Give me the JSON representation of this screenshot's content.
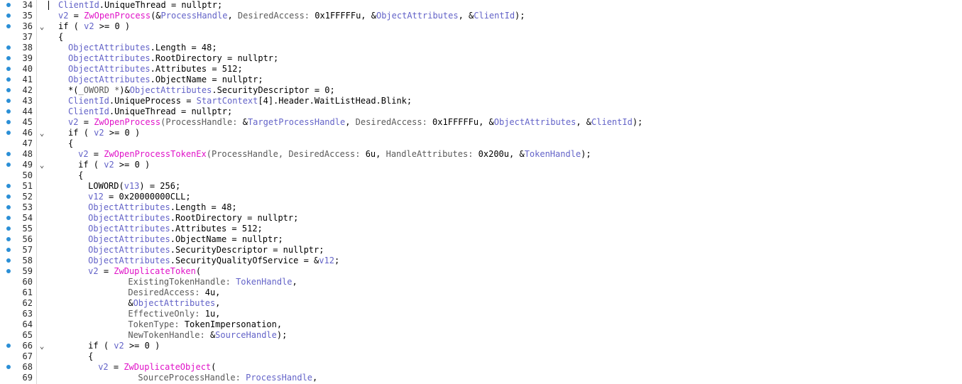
{
  "colors": {
    "default": "#000000",
    "variable": "#6363c8",
    "function": "#e012c8",
    "param_label": "#5a5a5a",
    "breakpoint": "#2b8fd6"
  },
  "icons": {
    "breakpoint": "breakpoint-dot-icon",
    "fold": "fold-chevron-down-icon"
  },
  "lines": [
    {
      "n": "34",
      "bp": true,
      "fold": false,
      "indent": 0,
      "segs": [
        [
          "v",
          "ClientId"
        ],
        [
          "d",
          ".UniqueThread = nullptr;"
        ]
      ]
    },
    {
      "n": "35",
      "bp": true,
      "fold": false,
      "indent": 0,
      "segs": [
        [
          "v",
          "v2"
        ],
        [
          "d",
          " = "
        ],
        [
          "f",
          "ZwOpenProcess"
        ],
        [
          "d",
          "(&"
        ],
        [
          "v",
          "ProcessHandle"
        ],
        [
          "d",
          ", "
        ],
        [
          "p",
          "DesiredAccess: "
        ],
        [
          "d",
          "0x1FFFFFu, &"
        ],
        [
          "v",
          "ObjectAttributes"
        ],
        [
          "d",
          ", &"
        ],
        [
          "v",
          "ClientId"
        ],
        [
          "d",
          ");"
        ]
      ]
    },
    {
      "n": "36",
      "bp": true,
      "fold": true,
      "indent": 0,
      "segs": [
        [
          "d",
          "if ( "
        ],
        [
          "v",
          "v2"
        ],
        [
          "d",
          " >= 0 )"
        ]
      ]
    },
    {
      "n": "37",
      "bp": false,
      "fold": false,
      "indent": 0,
      "segs": [
        [
          "d",
          "{"
        ]
      ]
    },
    {
      "n": "38",
      "bp": true,
      "fold": false,
      "indent": 1,
      "segs": [
        [
          "v",
          "ObjectAttributes"
        ],
        [
          "d",
          ".Length = 48;"
        ]
      ]
    },
    {
      "n": "39",
      "bp": true,
      "fold": false,
      "indent": 1,
      "segs": [
        [
          "v",
          "ObjectAttributes"
        ],
        [
          "d",
          ".RootDirectory = nullptr;"
        ]
      ]
    },
    {
      "n": "40",
      "bp": true,
      "fold": false,
      "indent": 1,
      "segs": [
        [
          "v",
          "ObjectAttributes"
        ],
        [
          "d",
          ".Attributes = 512;"
        ]
      ]
    },
    {
      "n": "41",
      "bp": true,
      "fold": false,
      "indent": 1,
      "segs": [
        [
          "v",
          "ObjectAttributes"
        ],
        [
          "d",
          ".ObjectName = nullptr;"
        ]
      ]
    },
    {
      "n": "42",
      "bp": true,
      "fold": false,
      "indent": 1,
      "segs": [
        [
          "d",
          "*("
        ],
        [
          "p",
          "_OWORD *"
        ],
        [
          "d",
          ")&"
        ],
        [
          "v",
          "ObjectAttributes"
        ],
        [
          "d",
          ".SecurityDescriptor = 0;"
        ]
      ]
    },
    {
      "n": "43",
      "bp": true,
      "fold": false,
      "indent": 1,
      "segs": [
        [
          "v",
          "ClientId"
        ],
        [
          "d",
          ".UniqueProcess = "
        ],
        [
          "v",
          "StartContext"
        ],
        [
          "d",
          "[4].Header.WaitListHead.Blink;"
        ]
      ]
    },
    {
      "n": "44",
      "bp": true,
      "fold": false,
      "indent": 1,
      "segs": [
        [
          "v",
          "ClientId"
        ],
        [
          "d",
          ".UniqueThread = nullptr;"
        ]
      ]
    },
    {
      "n": "45",
      "bp": true,
      "fold": false,
      "indent": 1,
      "segs": [
        [
          "v",
          "v2"
        ],
        [
          "d",
          " = "
        ],
        [
          "f",
          "ZwOpenProcess"
        ],
        [
          "p",
          "(ProcessHandle: "
        ],
        [
          "d",
          "&"
        ],
        [
          "v",
          "TargetProcessHandle"
        ],
        [
          "d",
          ", "
        ],
        [
          "p",
          "DesiredAccess: "
        ],
        [
          "d",
          "0x1FFFFFu, &"
        ],
        [
          "v",
          "ObjectAttributes"
        ],
        [
          "d",
          ", &"
        ],
        [
          "v",
          "ClientId"
        ],
        [
          "d",
          ");"
        ]
      ]
    },
    {
      "n": "46",
      "bp": true,
      "fold": true,
      "indent": 1,
      "segs": [
        [
          "d",
          "if ( "
        ],
        [
          "v",
          "v2"
        ],
        [
          "d",
          " >= 0 )"
        ]
      ]
    },
    {
      "n": "47",
      "bp": false,
      "fold": false,
      "indent": 1,
      "segs": [
        [
          "d",
          "{"
        ]
      ]
    },
    {
      "n": "48",
      "bp": true,
      "fold": false,
      "indent": 2,
      "segs": [
        [
          "v",
          "v2"
        ],
        [
          "d",
          " = "
        ],
        [
          "f",
          "ZwOpenProcessTokenEx"
        ],
        [
          "p",
          "(ProcessHandle, DesiredAccess: "
        ],
        [
          "d",
          "6u, "
        ],
        [
          "p",
          "HandleAttributes: "
        ],
        [
          "d",
          "0x200u, &"
        ],
        [
          "v",
          "TokenHandle"
        ],
        [
          "d",
          ");"
        ]
      ]
    },
    {
      "n": "49",
      "bp": true,
      "fold": true,
      "indent": 2,
      "segs": [
        [
          "d",
          "if ( "
        ],
        [
          "v",
          "v2"
        ],
        [
          "d",
          " >= 0 )"
        ]
      ]
    },
    {
      "n": "50",
      "bp": false,
      "fold": false,
      "indent": 2,
      "segs": [
        [
          "d",
          "{"
        ]
      ]
    },
    {
      "n": "51",
      "bp": true,
      "fold": false,
      "indent": 3,
      "segs": [
        [
          "d",
          "LOWORD("
        ],
        [
          "v",
          "v13"
        ],
        [
          "d",
          ") = 256;"
        ]
      ]
    },
    {
      "n": "52",
      "bp": true,
      "fold": false,
      "indent": 3,
      "segs": [
        [
          "v",
          "v12"
        ],
        [
          "d",
          " = 0x20000000CLL;"
        ]
      ]
    },
    {
      "n": "53",
      "bp": true,
      "fold": false,
      "indent": 3,
      "segs": [
        [
          "v",
          "ObjectAttributes"
        ],
        [
          "d",
          ".Length = 48;"
        ]
      ]
    },
    {
      "n": "54",
      "bp": true,
      "fold": false,
      "indent": 3,
      "segs": [
        [
          "v",
          "ObjectAttributes"
        ],
        [
          "d",
          ".RootDirectory = nullptr;"
        ]
      ]
    },
    {
      "n": "55",
      "bp": true,
      "fold": false,
      "indent": 3,
      "segs": [
        [
          "v",
          "ObjectAttributes"
        ],
        [
          "d",
          ".Attributes = 512;"
        ]
      ]
    },
    {
      "n": "56",
      "bp": true,
      "fold": false,
      "indent": 3,
      "segs": [
        [
          "v",
          "ObjectAttributes"
        ],
        [
          "d",
          ".ObjectName = nullptr;"
        ]
      ]
    },
    {
      "n": "57",
      "bp": true,
      "fold": false,
      "indent": 3,
      "segs": [
        [
          "v",
          "ObjectAttributes"
        ],
        [
          "d",
          ".SecurityDescriptor = nullptr;"
        ]
      ]
    },
    {
      "n": "58",
      "bp": true,
      "fold": false,
      "indent": 3,
      "segs": [
        [
          "v",
          "ObjectAttributes"
        ],
        [
          "d",
          ".SecurityQualityOfService = &"
        ],
        [
          "v",
          "v12"
        ],
        [
          "d",
          ";"
        ]
      ]
    },
    {
      "n": "59",
      "bp": true,
      "fold": false,
      "indent": 3,
      "segs": [
        [
          "v",
          "v2"
        ],
        [
          "d",
          " = "
        ],
        [
          "f",
          "ZwDuplicateToken"
        ],
        [
          "d",
          "("
        ]
      ]
    },
    {
      "n": "60",
      "bp": false,
      "fold": false,
      "indent": 7,
      "segs": [
        [
          "p",
          "ExistingTokenHandle: "
        ],
        [
          "v",
          "TokenHandle"
        ],
        [
          "d",
          ","
        ]
      ]
    },
    {
      "n": "61",
      "bp": false,
      "fold": false,
      "indent": 7,
      "segs": [
        [
          "p",
          "DesiredAccess: "
        ],
        [
          "d",
          "4u,"
        ]
      ]
    },
    {
      "n": "62",
      "bp": false,
      "fold": false,
      "indent": 7,
      "segs": [
        [
          "d",
          "&"
        ],
        [
          "v",
          "ObjectAttributes"
        ],
        [
          "d",
          ","
        ]
      ]
    },
    {
      "n": "63",
      "bp": false,
      "fold": false,
      "indent": 7,
      "segs": [
        [
          "p",
          "EffectiveOnly: "
        ],
        [
          "d",
          "1u,"
        ]
      ]
    },
    {
      "n": "64",
      "bp": false,
      "fold": false,
      "indent": 7,
      "segs": [
        [
          "p",
          "TokenType: "
        ],
        [
          "d",
          "TokenImpersonation,"
        ]
      ]
    },
    {
      "n": "65",
      "bp": false,
      "fold": false,
      "indent": 7,
      "segs": [
        [
          "p",
          "NewTokenHandle: "
        ],
        [
          "d",
          "&"
        ],
        [
          "v",
          "SourceHandle"
        ],
        [
          "d",
          ");"
        ]
      ]
    },
    {
      "n": "66",
      "bp": true,
      "fold": true,
      "indent": 3,
      "segs": [
        [
          "d",
          "if ( "
        ],
        [
          "v",
          "v2"
        ],
        [
          "d",
          " >= 0 )"
        ]
      ]
    },
    {
      "n": "67",
      "bp": false,
      "fold": false,
      "indent": 3,
      "segs": [
        [
          "d",
          "{"
        ]
      ]
    },
    {
      "n": "68",
      "bp": true,
      "fold": false,
      "indent": 4,
      "segs": [
        [
          "v",
          "v2"
        ],
        [
          "d",
          " = "
        ],
        [
          "f",
          "ZwDuplicateObject"
        ],
        [
          "d",
          "("
        ]
      ]
    },
    {
      "n": "69",
      "bp": false,
      "fold": false,
      "indent": 8,
      "segs": [
        [
          "p",
          "SourceProcessHandle: "
        ],
        [
          "v",
          "ProcessHandle"
        ],
        [
          "d",
          ","
        ]
      ]
    }
  ]
}
